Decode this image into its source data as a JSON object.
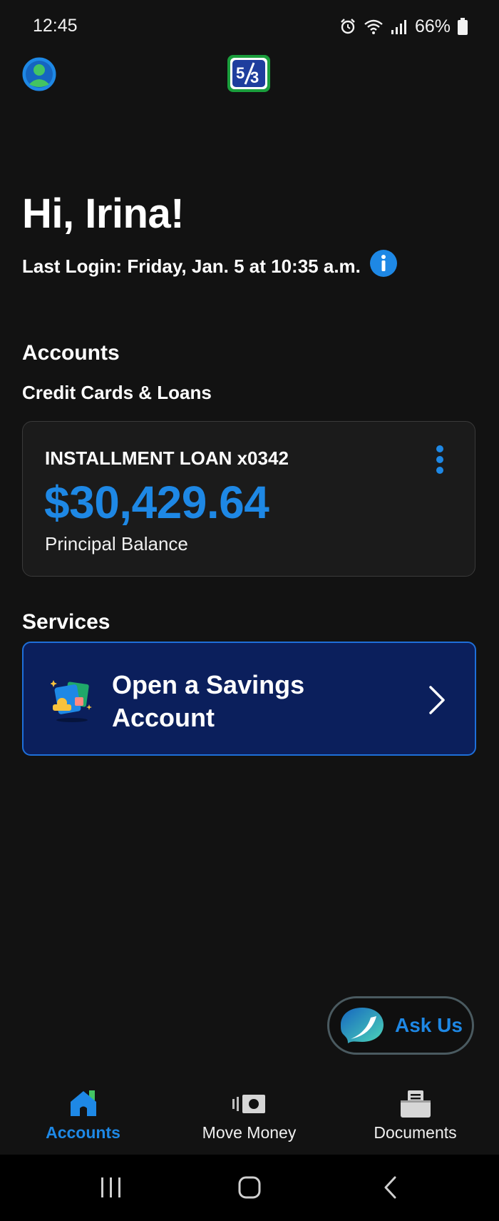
{
  "status_bar": {
    "time": "12:45",
    "battery": "66%"
  },
  "header": {
    "avatar_icon": "user-avatar-icon",
    "logo_icon": "bank-logo-icon"
  },
  "greeting": "Hi, Irina!",
  "last_login": "Last Login: Friday, Jan. 5 at 10:35 a.m.",
  "accounts": {
    "title": "Accounts",
    "subtitle": "Credit Cards & Loans",
    "loan": {
      "name": "INSTALLMENT LOAN x0342",
      "amount": "$30,429.64",
      "caption": "Principal Balance"
    }
  },
  "services": {
    "title": "Services",
    "savings_label": "Open a Savings Account"
  },
  "ask_us": {
    "label": "Ask Us"
  },
  "bottom_nav": [
    {
      "label": "Accounts",
      "icon": "home-icon",
      "active": true
    },
    {
      "label": "Move Money",
      "icon": "money-transfer-icon",
      "active": false
    },
    {
      "label": "Documents",
      "icon": "documents-icon",
      "active": false
    }
  ],
  "colors": {
    "background": "#121212",
    "accent": "#1e88e5",
    "card": "#1b1b1b",
    "savings_card": "#0b1f5c",
    "logo_green": "#1a9e3c"
  }
}
